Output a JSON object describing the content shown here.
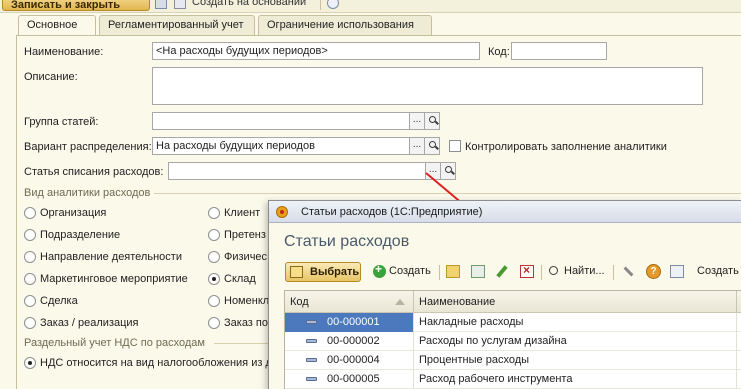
{
  "top_toolbar": {
    "main_button_label": "Записать и закрыть",
    "text": "Создать на основании"
  },
  "tabs": [
    {
      "label": "Основное",
      "active": true
    },
    {
      "label": "Регламентированный учет",
      "active": false
    },
    {
      "label": "Ограничение использования",
      "active": false
    }
  ],
  "form": {
    "name_label": "Наименование:",
    "name_value": "<На расходы будущих периодов>",
    "code_label": "Код:",
    "code_value": "",
    "description_label": "Описание:",
    "description_value": "",
    "group_label": "Группа статей:",
    "group_value": "",
    "distribution_label": "Вариант распределения:",
    "distribution_value": "На расходы будущих периодов",
    "control_checkbox_label": "Контролировать заполнение аналитики",
    "control_checkbox_checked": false,
    "writeoff_label": "Статья списания расходов:",
    "writeoff_value": "",
    "analytics_section_label": "Вид аналитики расходов",
    "analytics_options_col1": [
      {
        "label": "Организация",
        "selected": false
      },
      {
        "label": "Подразделение",
        "selected": false
      },
      {
        "label": "Направление деятельности",
        "selected": false
      },
      {
        "label": "Маркетинговое мероприятие",
        "selected": false
      },
      {
        "label": "Сделка",
        "selected": false
      },
      {
        "label": "Заказ / реализация",
        "selected": false
      }
    ],
    "analytics_options_col2": [
      {
        "label": "Клиент",
        "selected": false
      },
      {
        "label": "Претенз",
        "selected": false
      },
      {
        "label": "Физичес",
        "selected": false
      },
      {
        "label": "Склад",
        "selected": true
      },
      {
        "label": "Номенкл",
        "selected": false
      },
      {
        "label": "Заказ по",
        "selected": false
      }
    ],
    "vat_section_label": "Раздельный учет НДС по расходам",
    "vat_option_label": "НДС относится на вид налогообложения из д",
    "vat_option_selected": true
  },
  "popup": {
    "window_title": "Статьи расходов (1С:Предприятие)",
    "heading": "Статьи расходов",
    "toolbar": {
      "select_label": "Выбрать",
      "create_label": "Создать",
      "find_label": "Найти...",
      "help_icon_text": "?",
      "create2_label": "Создать"
    },
    "table": {
      "columns": [
        "Код",
        "Наименование"
      ],
      "rows": [
        {
          "code": "00-000001",
          "name": "Накладные расходы",
          "selected": true
        },
        {
          "code": "00-000002",
          "name": "Расходы по услугам дизайна",
          "selected": false
        },
        {
          "code": "00-000004",
          "name": "Процентные расходы",
          "selected": false
        },
        {
          "code": "00-000005",
          "name": "Расход рабочего инструмента",
          "selected": false
        }
      ]
    }
  },
  "colors": {
    "background": "#fbf9ea",
    "accent_button": "#e2b64d",
    "selection": "#4c79bd",
    "arrow": "#e02020"
  }
}
